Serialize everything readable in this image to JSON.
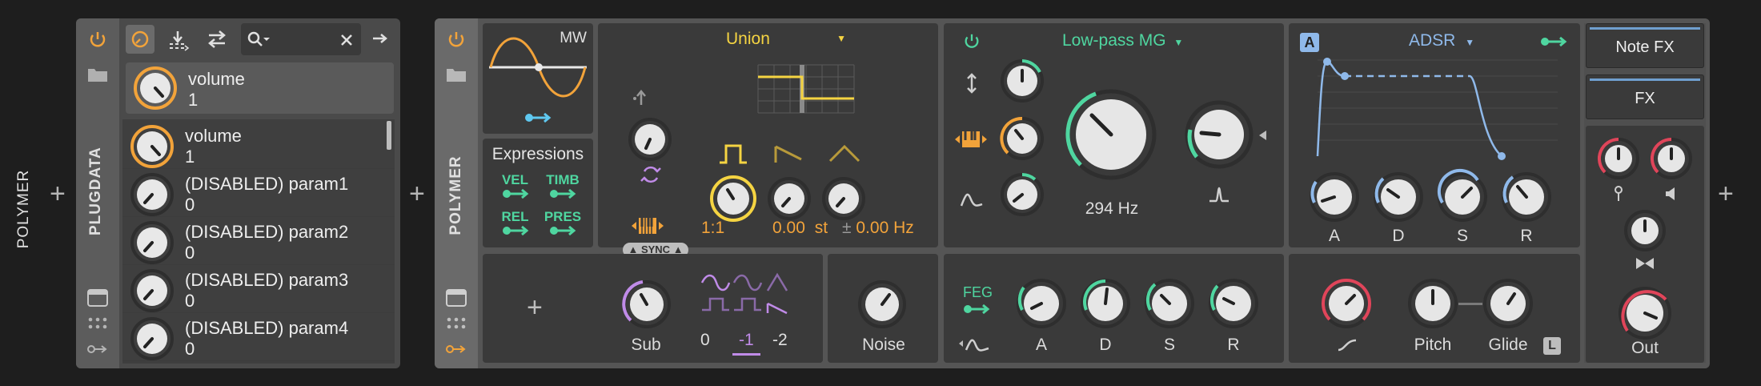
{
  "chain": {
    "left_label": "POLYMER"
  },
  "plugdata": {
    "title": "PLUGDATA",
    "top_param": {
      "name": "volume",
      "value": "1"
    },
    "params": [
      {
        "name": "volume",
        "value": "1"
      },
      {
        "name": "(DISABLED) param1",
        "value": "0"
      },
      {
        "name": "(DISABLED) param2",
        "value": "0"
      },
      {
        "name": "(DISABLED) param3",
        "value": "0"
      },
      {
        "name": "(DISABLED) param4",
        "value": "0"
      }
    ]
  },
  "polymer": {
    "title": "POLYMER",
    "lfo": {
      "label": "MW"
    },
    "expressions": {
      "title": "Expressions",
      "items": [
        "VEL",
        "TIMB",
        "REL",
        "PRES"
      ]
    },
    "osc": {
      "mode": "Union",
      "ratio": "1:1",
      "pitch": "0.00",
      "pitch_unit": "st",
      "fine_prefix": "±",
      "fine": "0.00 Hz",
      "sync_label": "SYNC"
    },
    "sub": {
      "label": "Sub",
      "octaves": [
        "0",
        "-1",
        "-2"
      ],
      "selected": "-1"
    },
    "noise": {
      "label": "Noise"
    },
    "filter": {
      "type": "Low-pass MG",
      "freq": "294 Hz"
    },
    "feg": {
      "label": "FEG",
      "knobs": [
        "A",
        "D",
        "S",
        "R"
      ]
    },
    "adsr": {
      "badge": "A",
      "title": "ADSR",
      "knobs": [
        "A",
        "D",
        "S",
        "R"
      ]
    },
    "vca": {
      "pitch": "Pitch",
      "glide": "Glide",
      "glide_badge": "L"
    },
    "fx": {
      "note_fx": "Note FX",
      "fx": "FX",
      "out": "Out"
    }
  },
  "colors": {
    "accent_orange": "#f2a33a",
    "osc_yellow": "#f5d442",
    "filter_green": "#4fd6a0",
    "env_blue": "#8fb9ea",
    "sub_purple": "#c08be8",
    "out_red": "#e0455a"
  }
}
